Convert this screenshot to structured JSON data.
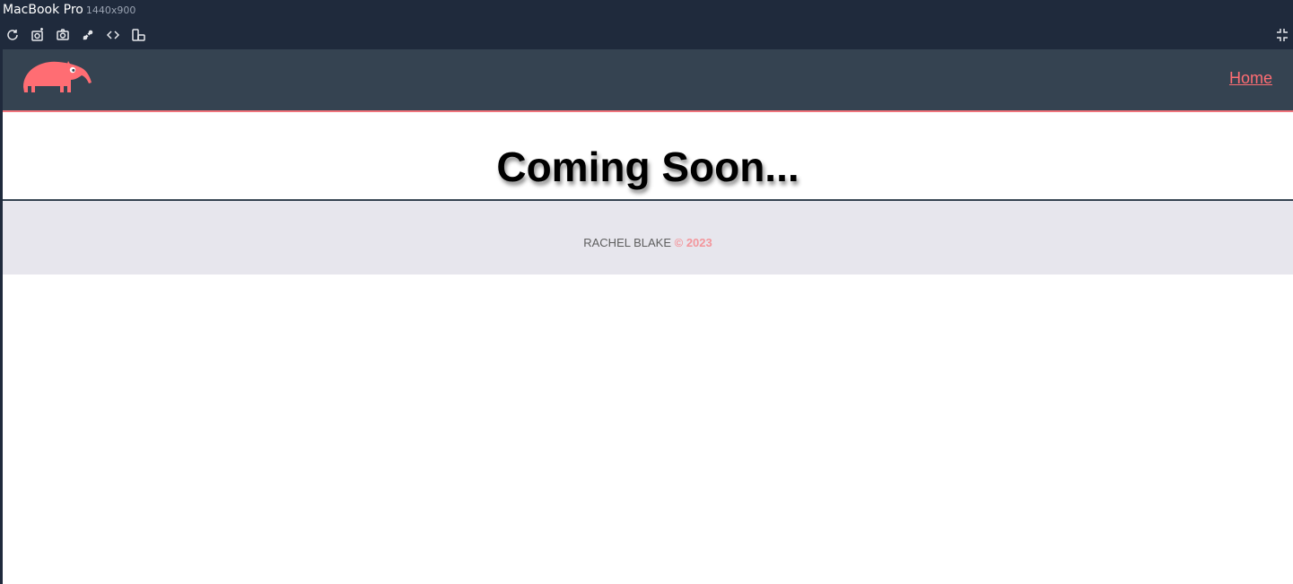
{
  "devtools": {
    "device_name": "MacBook Pro",
    "device_size": "1440x900",
    "tools": [
      "refresh-icon",
      "screenshot-icon",
      "camera-icon",
      "link-icon",
      "code-icon",
      "device-rotate-icon"
    ],
    "collapse_icon": "collapse-icon"
  },
  "header": {
    "logo": "anteater-logo",
    "nav_home": "Home",
    "accent_color": "#ff6d73",
    "background": "#354351"
  },
  "hero": {
    "title": "Coming Soon..."
  },
  "footer": {
    "name": "RACHEL BLAKE",
    "copyright": "© 2023",
    "background": "#e7e6ed"
  }
}
